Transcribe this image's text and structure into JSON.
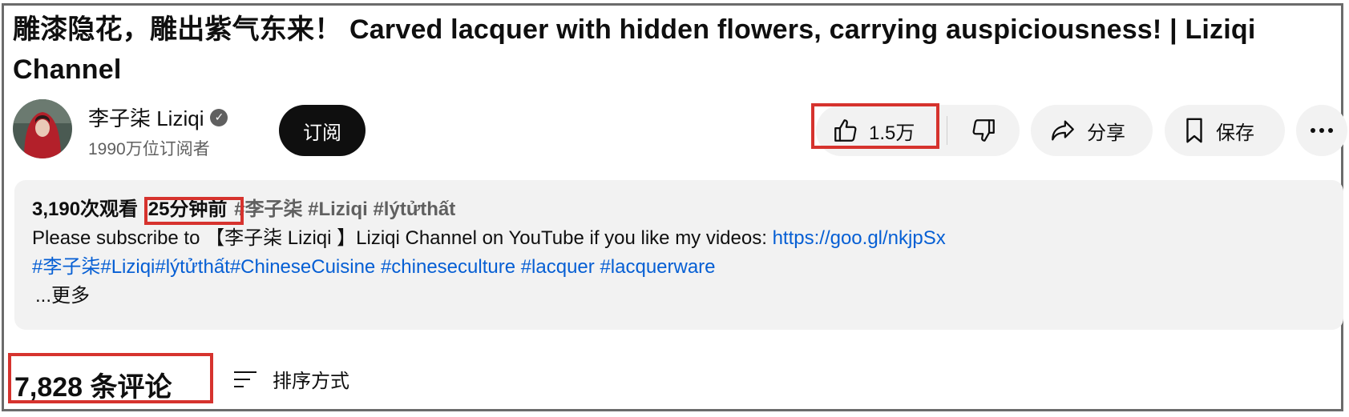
{
  "video": {
    "title": "雕漆隐花，雕出紫气东来！ Carved lacquer with hidden flowers, carrying auspiciousness! | Liziqi Channel"
  },
  "channel": {
    "name": "李子柒 Liziqi",
    "subscribers": "1990万位订阅者",
    "subscribe_label": "订阅"
  },
  "actions": {
    "like_count": "1.5万",
    "share_label": "分享",
    "save_label": "保存"
  },
  "description": {
    "views": "3,190次观看",
    "time_ago": "25分钟前",
    "meta_tags": "#李子柒 #Liziqi #lýtửthất",
    "line1_text": "Please  subscribe to 【李子柒 Liziqi 】Liziqi Channel on YouTube if you like my videos: ",
    "line1_link": "https://goo.gl/nkjpSx",
    "hashtags": "#李子柒#Liziqi#lýtửthất#ChineseCuisine #chineseculture #lacquer #lacquerware",
    "more_label": "...更多"
  },
  "comments": {
    "count_label": "7,828 条评论",
    "sort_label": "排序方式"
  },
  "colors": {
    "highlight": "#d6332e",
    "link": "#065fd4",
    "pill_bg": "#f2f2f2"
  }
}
